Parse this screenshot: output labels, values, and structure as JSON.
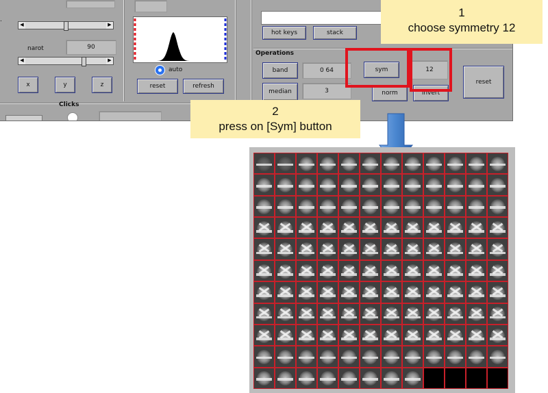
{
  "left_panel": {
    "narot_label": "narot",
    "narot_value": "90",
    "axis_buttons": [
      "x",
      "y",
      "z"
    ]
  },
  "histogram": {
    "auto_label": "auto",
    "reset_label": "reset",
    "refresh_label": "refresh"
  },
  "right_panel": {
    "hotkeys_label": "hot keys",
    "stack_label": "stack",
    "operations_title": "Operations",
    "band_label": "band",
    "band_value": "0  64",
    "sym_label": "sym",
    "sym_value": "12",
    "reset_label": "reset",
    "median_label": "median",
    "median_value": "3",
    "norm_label": "norm",
    "invert_label": "invert"
  },
  "clicks": {
    "title": "Clicks"
  },
  "callouts": {
    "step1_number": "1",
    "step1_text": "choose symmetry 12",
    "step2_number": "2",
    "step2_text": "press on [Sym] button"
  },
  "colors": {
    "panel_bg": "#a6a6a6",
    "highlight_red": "#e0141e",
    "callout_bg": "#fdefb0",
    "arrow_blue": "#4a86cf",
    "tile_border": "#c8202a"
  },
  "gallery": {
    "rows": 11,
    "cols": 12,
    "black_tiles_last_row": 4
  }
}
